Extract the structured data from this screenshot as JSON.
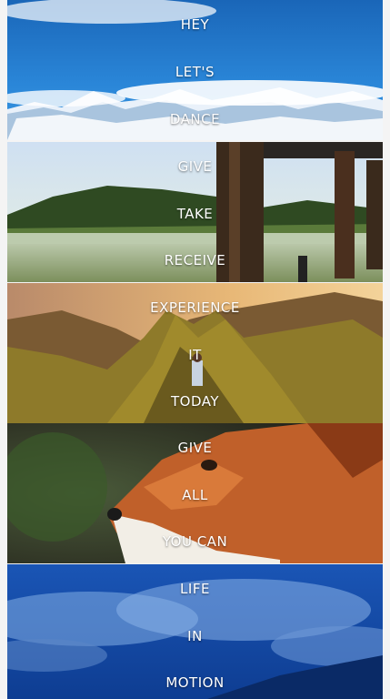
{
  "panels": [
    {
      "id": "mountains",
      "words": [
        "HEY",
        "LET'S",
        "DANCE"
      ]
    },
    {
      "id": "lake",
      "words": [
        "GIVE",
        "TAKE",
        "RECEIVE"
      ]
    },
    {
      "id": "ridge",
      "words": [
        "EXPERIENCE",
        "IT",
        "TODAY"
      ]
    },
    {
      "id": "fox",
      "words": [
        "GIVE",
        "ALL",
        "YOU CAN"
      ]
    },
    {
      "id": "sky",
      "words": [
        "LIFE",
        "IN",
        "MOTION"
      ]
    }
  ],
  "colors": {
    "text": "#ffffff",
    "page_bg": "#f4f4f4",
    "sky_blue": "#1d6fc4",
    "forest_green": "#3c5a2a",
    "sunset_gold": "#d6a24a",
    "fox_orange": "#c8642a",
    "deep_blue": "#1a55b5"
  }
}
